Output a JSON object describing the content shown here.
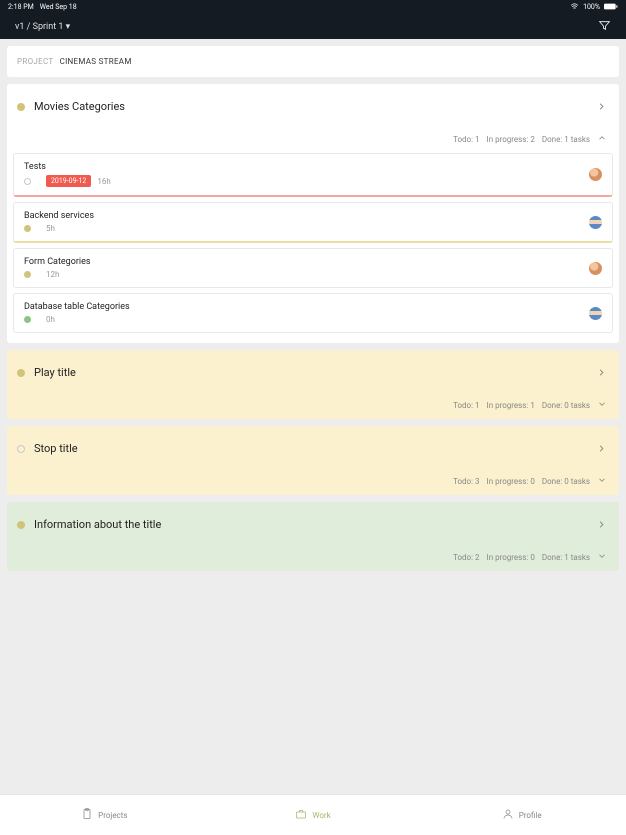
{
  "status_bar": {
    "time": "2:18 PM",
    "date": "Wed Sep 18",
    "battery": "100%"
  },
  "header": {
    "path": "v1 / Sprint 1"
  },
  "breadcrumb": {
    "label": "PROJECT",
    "name": "CINEMAS STREAM"
  },
  "sections": [
    {
      "title": "Movies Categories",
      "dot": "yellow",
      "bg": "white",
      "expanded": true,
      "stats": {
        "todo": "Todo: 1",
        "progress": "In progress: 2",
        "done": "Done: 1 tasks"
      },
      "tasks": [
        {
          "name": "Tests",
          "dot": "open",
          "date": "2019-09-12",
          "hours": "16h",
          "avatar": "1",
          "border": "red"
        },
        {
          "name": "Backend services",
          "dot": "yellow",
          "hours": "5h",
          "avatar": "2",
          "border": "yellow"
        },
        {
          "name": "Form Categories",
          "dot": "yellow",
          "hours": "12h",
          "avatar": "1",
          "border": ""
        },
        {
          "name": "Database table Categories",
          "dot": "green",
          "hours": "0h",
          "avatar": "2",
          "border": ""
        }
      ]
    },
    {
      "title": "Play title",
      "dot": "yellow",
      "bg": "yellow",
      "expanded": false,
      "stats": {
        "todo": "Todo: 1",
        "progress": "In progress: 1",
        "done": "Done: 0  tasks"
      }
    },
    {
      "title": "Stop title",
      "dot": "open",
      "bg": "yellow",
      "expanded": false,
      "stats": {
        "todo": "Todo: 3",
        "progress": "In progress: 0",
        "done": "Done: 0  tasks"
      }
    },
    {
      "title": "Information about the title",
      "dot": "yellow",
      "bg": "green",
      "expanded": false,
      "stats": {
        "todo": "Todo: 2",
        "progress": "In progress: 0",
        "done": "Done: 1 tasks"
      }
    }
  ],
  "nav": {
    "projects": "Projects",
    "work": "Work",
    "profile": "Profile"
  }
}
